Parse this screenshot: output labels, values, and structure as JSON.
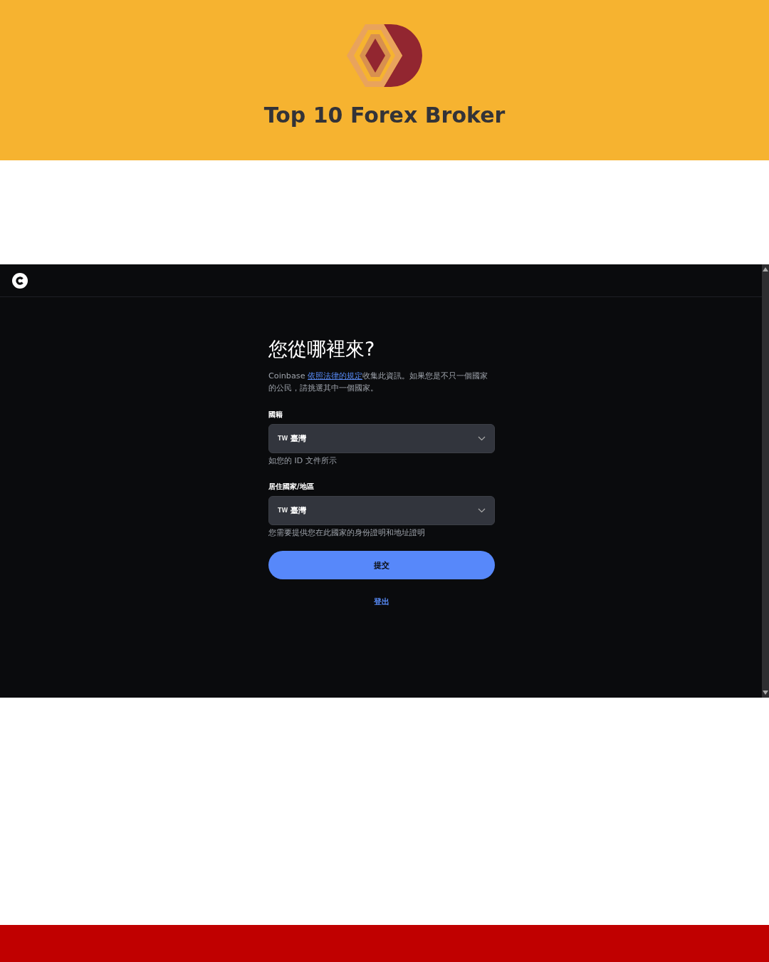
{
  "banner": {
    "title": "Top 10 Forex Broker"
  },
  "form": {
    "heading": "您從哪裡來?",
    "intro": {
      "before": "Coinbase ",
      "link": "依照法律的規定",
      "after": "收集此資訊。如果您是不只一個國家的公民，請挑選其中一個國家。"
    },
    "fields": [
      {
        "label": "國籍",
        "code": "TW",
        "value": "臺灣",
        "helper": "如您的 ID 文件所示"
      },
      {
        "label": "居住國家/地區",
        "code": "TW",
        "value": "臺灣",
        "helper": "您需要提供您在此國家的身份證明和地址證明"
      }
    ],
    "submit": "提交",
    "signout": "登出"
  }
}
